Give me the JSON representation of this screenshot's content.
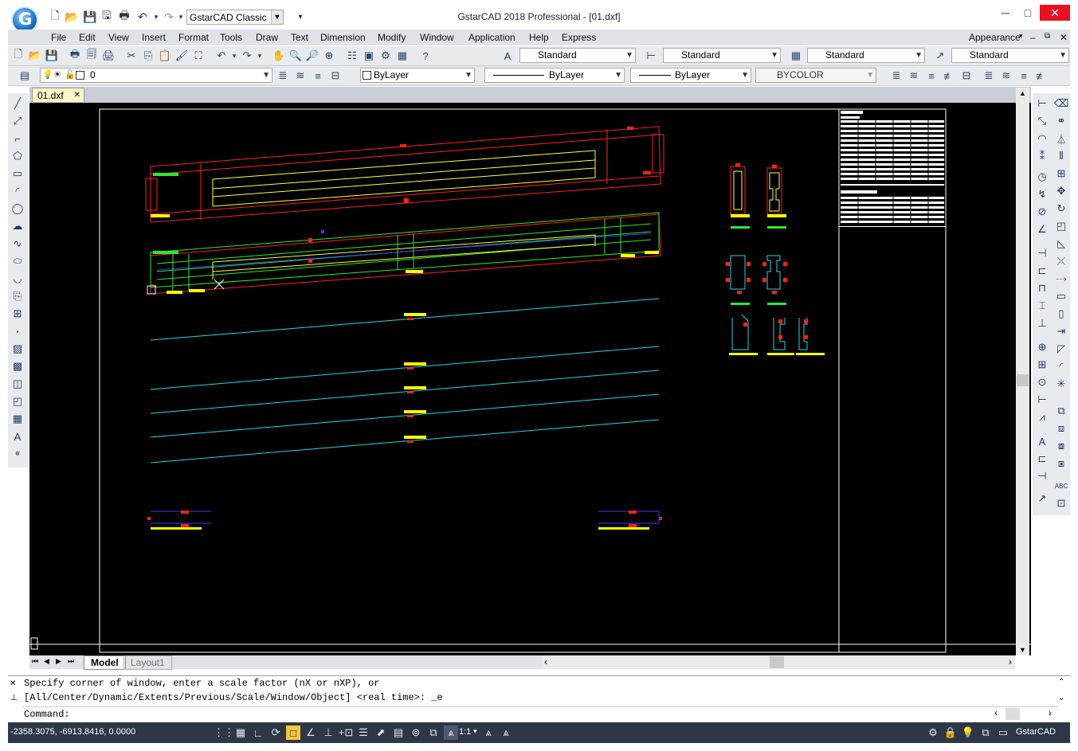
{
  "app": {
    "title": "GstarCAD 2018 Professional - [01.dxf]",
    "logo_letter": "G",
    "workspace": "GstarCAD Classic"
  },
  "window_controls": {
    "minimize": "─",
    "restore": "□",
    "close": "✕"
  },
  "menu": [
    "File",
    "Edit",
    "View",
    "Insert",
    "Format",
    "Tools",
    "Draw",
    "Text",
    "Dimension",
    "Modify",
    "Window",
    "Application",
    "Help",
    "Express"
  ],
  "menu_right": "Appearance",
  "toolbar": {
    "text_style": "Standard",
    "dim_style": "Standard",
    "table_style": "Standard",
    "mleader_style": "Standard",
    "layer": "0",
    "color": "ByLayer",
    "linetype": "ByLayer",
    "lineweight": "ByLayer",
    "plot_style": "BYCOLOR"
  },
  "document_tab": "01.dxf",
  "layout_tabs": {
    "model": "Model",
    "layout1": "Layout1"
  },
  "command": {
    "history_line1": "Specify corner of window, enter a scale factor (nX or nXP), or",
    "history_line2": "[All/Center/Dynamic/Extents/Previous/Scale/Window/Object] <real time>: _e",
    "prompt": "Command:"
  },
  "status": {
    "coordinates": "-2358.3075, -6913.8416, 0.0000",
    "annotation_scale": "1:1",
    "app_name": "GstarCAD"
  },
  "colors": {
    "canvas": "#000000",
    "red": "#ff2020",
    "green": "#2ee82e",
    "yellow": "#ffff00",
    "cyan": "#22d6e6",
    "blue": "#3a3aff",
    "status_bg": "#2e3746"
  },
  "icons": {
    "left_toolbar": [
      "line-icon",
      "construction-line-icon",
      "polyline-icon",
      "polygon-icon",
      "rectangle-icon",
      "arc-icon",
      "circle-icon",
      "revision-cloud-icon",
      "spline-icon",
      "ellipse-icon",
      "ellipse-arc-icon",
      "insert-block-icon",
      "make-block-icon",
      "point-icon",
      "hatch-icon",
      "gradient-icon",
      "region-icon",
      "table-icon",
      "wipeout-icon",
      "multiline-text-icon",
      "add-selected-icon"
    ],
    "right_toolbar1": [
      "linear-dimension-icon",
      "aligned-dimension-icon",
      "arc-length-icon",
      "ordinate-icon",
      "radius-icon",
      "jogged-icon",
      "diameter-icon",
      "angular-icon",
      "quick-dimension-icon",
      "baseline-icon",
      "continue-icon",
      "dimension-space-icon",
      "dimension-break-icon",
      "tolerance-icon",
      "center-mark-icon",
      "inspection-icon",
      "jogged-linear-icon",
      "dimension-edit-icon",
      "dimension-text-edit-icon",
      "dimension-update-icon",
      "dimension-style-icon"
    ],
    "right_toolbar2": [
      "erase-icon",
      "copy-icon",
      "mirror-icon",
      "offset-icon",
      "array-icon",
      "move-icon",
      "rotate-icon",
      "scale-icon",
      "stretch-icon",
      "trim-icon",
      "extend-icon",
      "break-at-point-icon",
      "break-icon",
      "join-icon",
      "chamfer-icon",
      "fillet-icon",
      "explode-icon",
      "draw-order-icon",
      "bring-front-icon",
      "send-back-icon",
      "spell-check-icon",
      "text-to-front-icon"
    ]
  }
}
